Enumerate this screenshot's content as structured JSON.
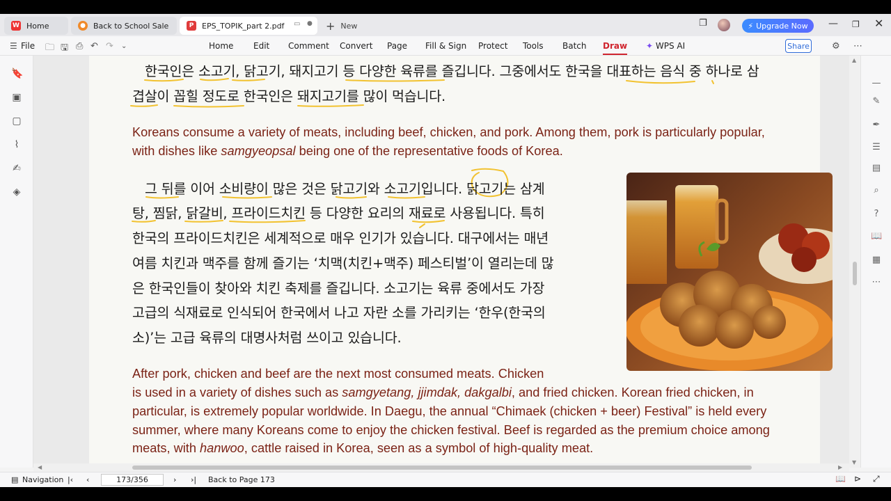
{
  "tabs": [
    {
      "label": "Home",
      "icon": "wps-logo-icon"
    },
    {
      "label": "Back to School Sale",
      "icon": "sale-icon"
    },
    {
      "label": "EPS_TOPIK_part 2.pdf",
      "icon": "pdf-icon"
    }
  ],
  "new_tab_label": "New",
  "upgrade_label": "Upgrade Now",
  "menu": {
    "file": "File",
    "items": [
      "Home",
      "Edit",
      "Comment",
      "Convert",
      "Page",
      "Fill & Sign",
      "Protect",
      "Tools",
      "Batch",
      "Draw",
      "WPS AI"
    ],
    "active": "Draw",
    "share": "Share"
  },
  "document": {
    "kr_para1": [
      "한국인은 소고기, 닭고기, 돼지고기 등 다양한 육류를 즐깁니다. 그중에서도 한국을 대표하는 음식 중 하나로 삼",
      "겹살이 꼽힐 정도로 한국인은 돼지고기를 많이 먹습니다."
    ],
    "en_para1": [
      "Koreans consume a variety of meats, including beef, chicken, and pork. Among them, pork is particularly popular,",
      "with dishes like ",
      "samgyeopsal",
      " being one of the representative foods of Korea."
    ],
    "kr_para2": [
      "그 뒤를 이어 소비량이 많은 것은 닭고기와 소고기입니다. 닭고기는 삼계",
      "탕, 찜닭, 닭갈비, 프라이드치킨 등 다양한 요리의 재료로 사용됩니다. 특히",
      "한국의 프라이드치킨은 세계적으로 매우 인기가 있습니다. 대구에서는 매년",
      "여름 치킨과 맥주를 함께 즐기는 ‘치맥(치킨+맥주) 페스티벌’이 열리는데 많",
      "은 한국인들이 찾아와 치킨 축제를 즐깁니다. 소고기는 육류 중에서도 가장",
      "고급의 식재료로 인식되어 한국에서 나고 자란 소를 가리키는 ‘한우(한국의",
      "소)’는 고급 육류의 대명사처럼 쓰이고 있습니다."
    ],
    "en_para2": {
      "line1": "After pork, chicken and beef are the next most consumed meats. Chicken",
      "line2_a": "is used in a variety of dishes such as ",
      "line2_i": "samgyetang, jjimdak, dakgalbi",
      "line2_b": ", and fried chicken. Korean fried chicken, in",
      "line3": "particular, is extremely popular worldwide. In Daegu, the annual “Chimaek (chicken + beer) Festival” is held every",
      "line4": "summer, where many Koreans come to enjoy the chicken festival. Beef is regarded as the premium choice among",
      "line5_a": "meats, with ",
      "line5_i": "hanwoo",
      "line5_b": ", cattle raised in Korea, seen as a symbol of high-quality meat."
    }
  },
  "status": {
    "navigation": "Navigation",
    "page_value": "173/356",
    "back_to_page": "Back to Page 173"
  },
  "colors": {
    "accent": "#d0252e",
    "english_text": "#7b2316",
    "annotation": "#f2c230",
    "upgrade": "#3b8bff"
  }
}
